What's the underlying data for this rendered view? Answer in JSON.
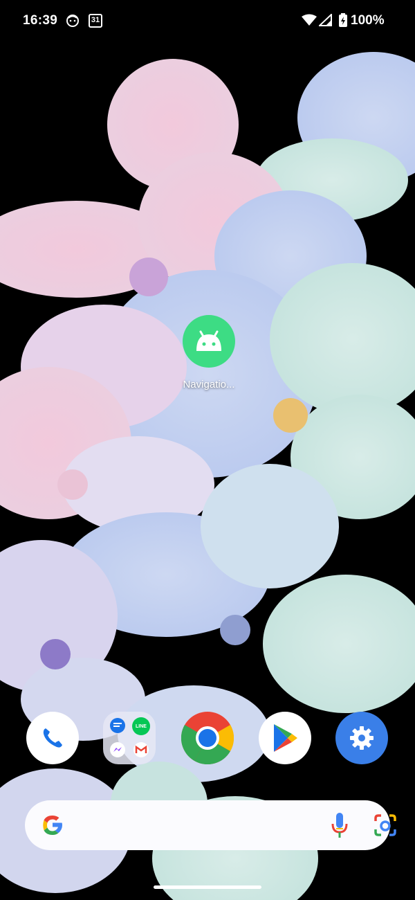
{
  "status_bar": {
    "time": "16:39",
    "calendar_day": "31",
    "battery": "100%",
    "icons": [
      "face-icon",
      "calendar-icon",
      "wifi-icon",
      "cell-signal-icon",
      "battery-charging-icon"
    ]
  },
  "home": {
    "app": {
      "label": "Navigatio...",
      "icon": "android-icon",
      "color": "#3ddc84"
    }
  },
  "folder": {
    "apps": [
      "messages-icon",
      "line-icon",
      "messenger-icon",
      "gmail-icon"
    ],
    "line_label": "LINE"
  },
  "dock": [
    {
      "name": "Phone",
      "icon": "phone-icon"
    },
    {
      "name": "Chrome",
      "icon": "chrome-icon"
    },
    {
      "name": "Play Store",
      "icon": "play-store-icon"
    },
    {
      "name": "Settings",
      "icon": "settings-icon"
    }
  ],
  "search": {
    "placeholder": ""
  },
  "colors": {
    "accent": "#3a7fe8",
    "android_green": "#3ddc84"
  }
}
